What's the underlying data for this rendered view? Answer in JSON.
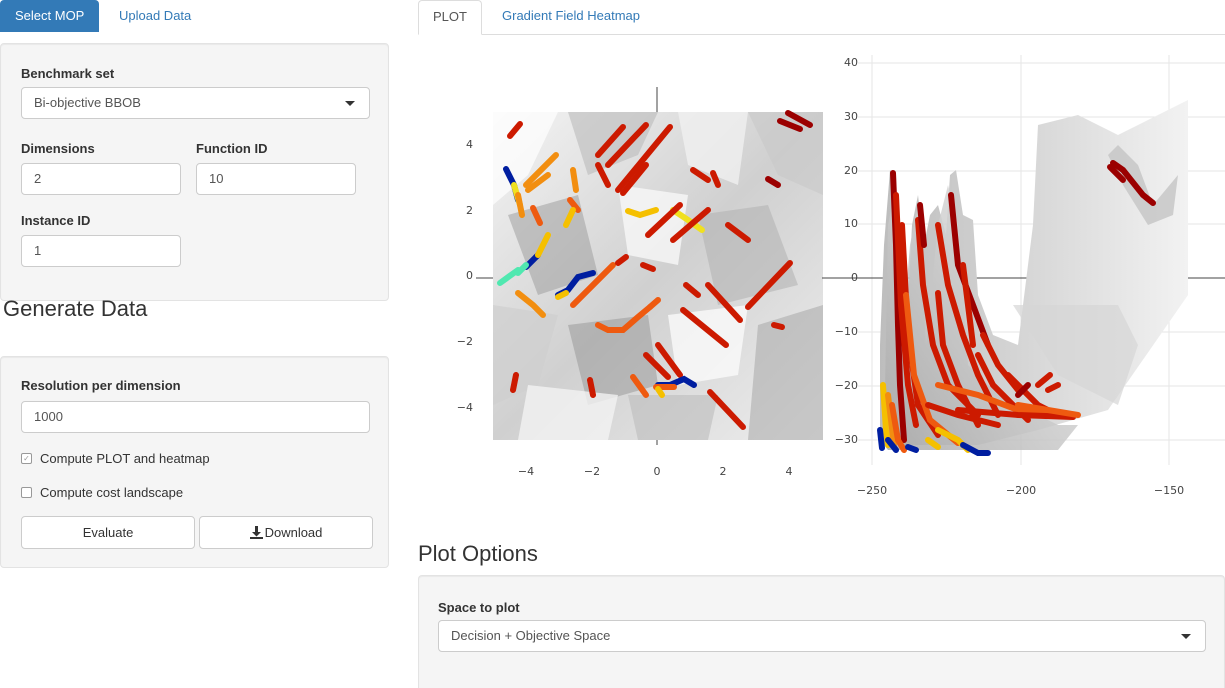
{
  "left_tabs": {
    "active": "Select MOP",
    "other": "Upload Data"
  },
  "mop_form": {
    "benchmark_label": "Benchmark set",
    "benchmark_value": "Bi-objective BBOB",
    "dimensions_label": "Dimensions",
    "dimensions_value": "2",
    "function_label": "Function ID",
    "function_value": "10",
    "instance_label": "Instance ID",
    "instance_value": "1"
  },
  "generate": {
    "title": "Generate Data",
    "resolution_label": "Resolution per dimension",
    "resolution_value": "1000",
    "compute_plot_label": "Compute PLOT and heatmap",
    "compute_plot_checked": true,
    "compute_cost_label": "Compute cost landscape",
    "compute_cost_checked": false,
    "evaluate_label": "Evaluate",
    "download_label": "Download"
  },
  "right_tabs": {
    "active": "PLOT",
    "other": "Gradient Field Heatmap"
  },
  "plot_options": {
    "title": "Plot Options",
    "space_label": "Space to plot",
    "space_value": "Decision + Objective Space"
  },
  "chart_data": [
    {
      "type": "heatmap",
      "title": "",
      "xlabel": "",
      "ylabel": "",
      "xlim": [
        -5,
        5
      ],
      "ylim": [
        -5,
        5
      ],
      "x_ticks": [
        "−4",
        "−2",
        "0",
        "2",
        "4"
      ],
      "y_ticks": [
        "4",
        "2",
        "0",
        "−2",
        "−4"
      ],
      "colors": {
        "background": "#e8e8e8",
        "segments": [
          "#cc1a00",
          "#ee5a10",
          "#f28e10",
          "#f5c000",
          "#f0e020",
          "#50e8b0",
          "#001ea0",
          "#9b0000"
        ]
      }
    },
    {
      "type": "scatter",
      "title": "",
      "xlabel": "",
      "ylabel": "",
      "xlim": [
        -260,
        -140
      ],
      "ylim": [
        -33,
        42
      ],
      "x_ticks": [
        "−250",
        "−200",
        "−150"
      ],
      "y_ticks": [
        "40",
        "30",
        "20",
        "10",
        "0",
        "−10",
        "−20",
        "−30"
      ]
    }
  ]
}
